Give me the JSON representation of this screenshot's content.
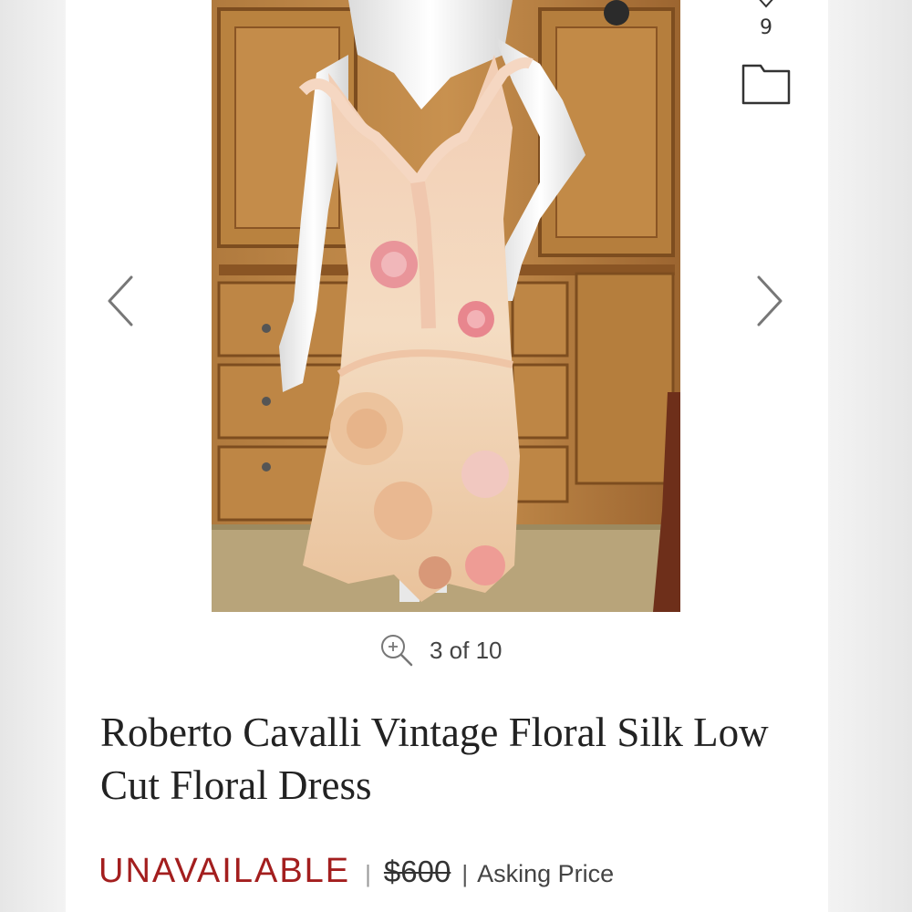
{
  "favorites": {
    "count": "9",
    "icon": "heart-icon"
  },
  "save_folder": {
    "icon": "folder-icon"
  },
  "carousel": {
    "prev_icon": "chevron-left-icon",
    "next_icon": "chevron-right-icon",
    "zoom_icon": "zoom-in-icon",
    "counter": "3 of 10",
    "current": 3,
    "total": 10
  },
  "product": {
    "title": "Roberto Cavalli Vintage Floral Silk Low Cut Floral Dress",
    "status": "UNAVAILABLE",
    "separator": "|",
    "original_price": "$600",
    "price_separator": "|",
    "price_label": "Asking Price"
  },
  "colors": {
    "status": "#a31e1e",
    "background": "#ffffff",
    "text": "#222222"
  }
}
